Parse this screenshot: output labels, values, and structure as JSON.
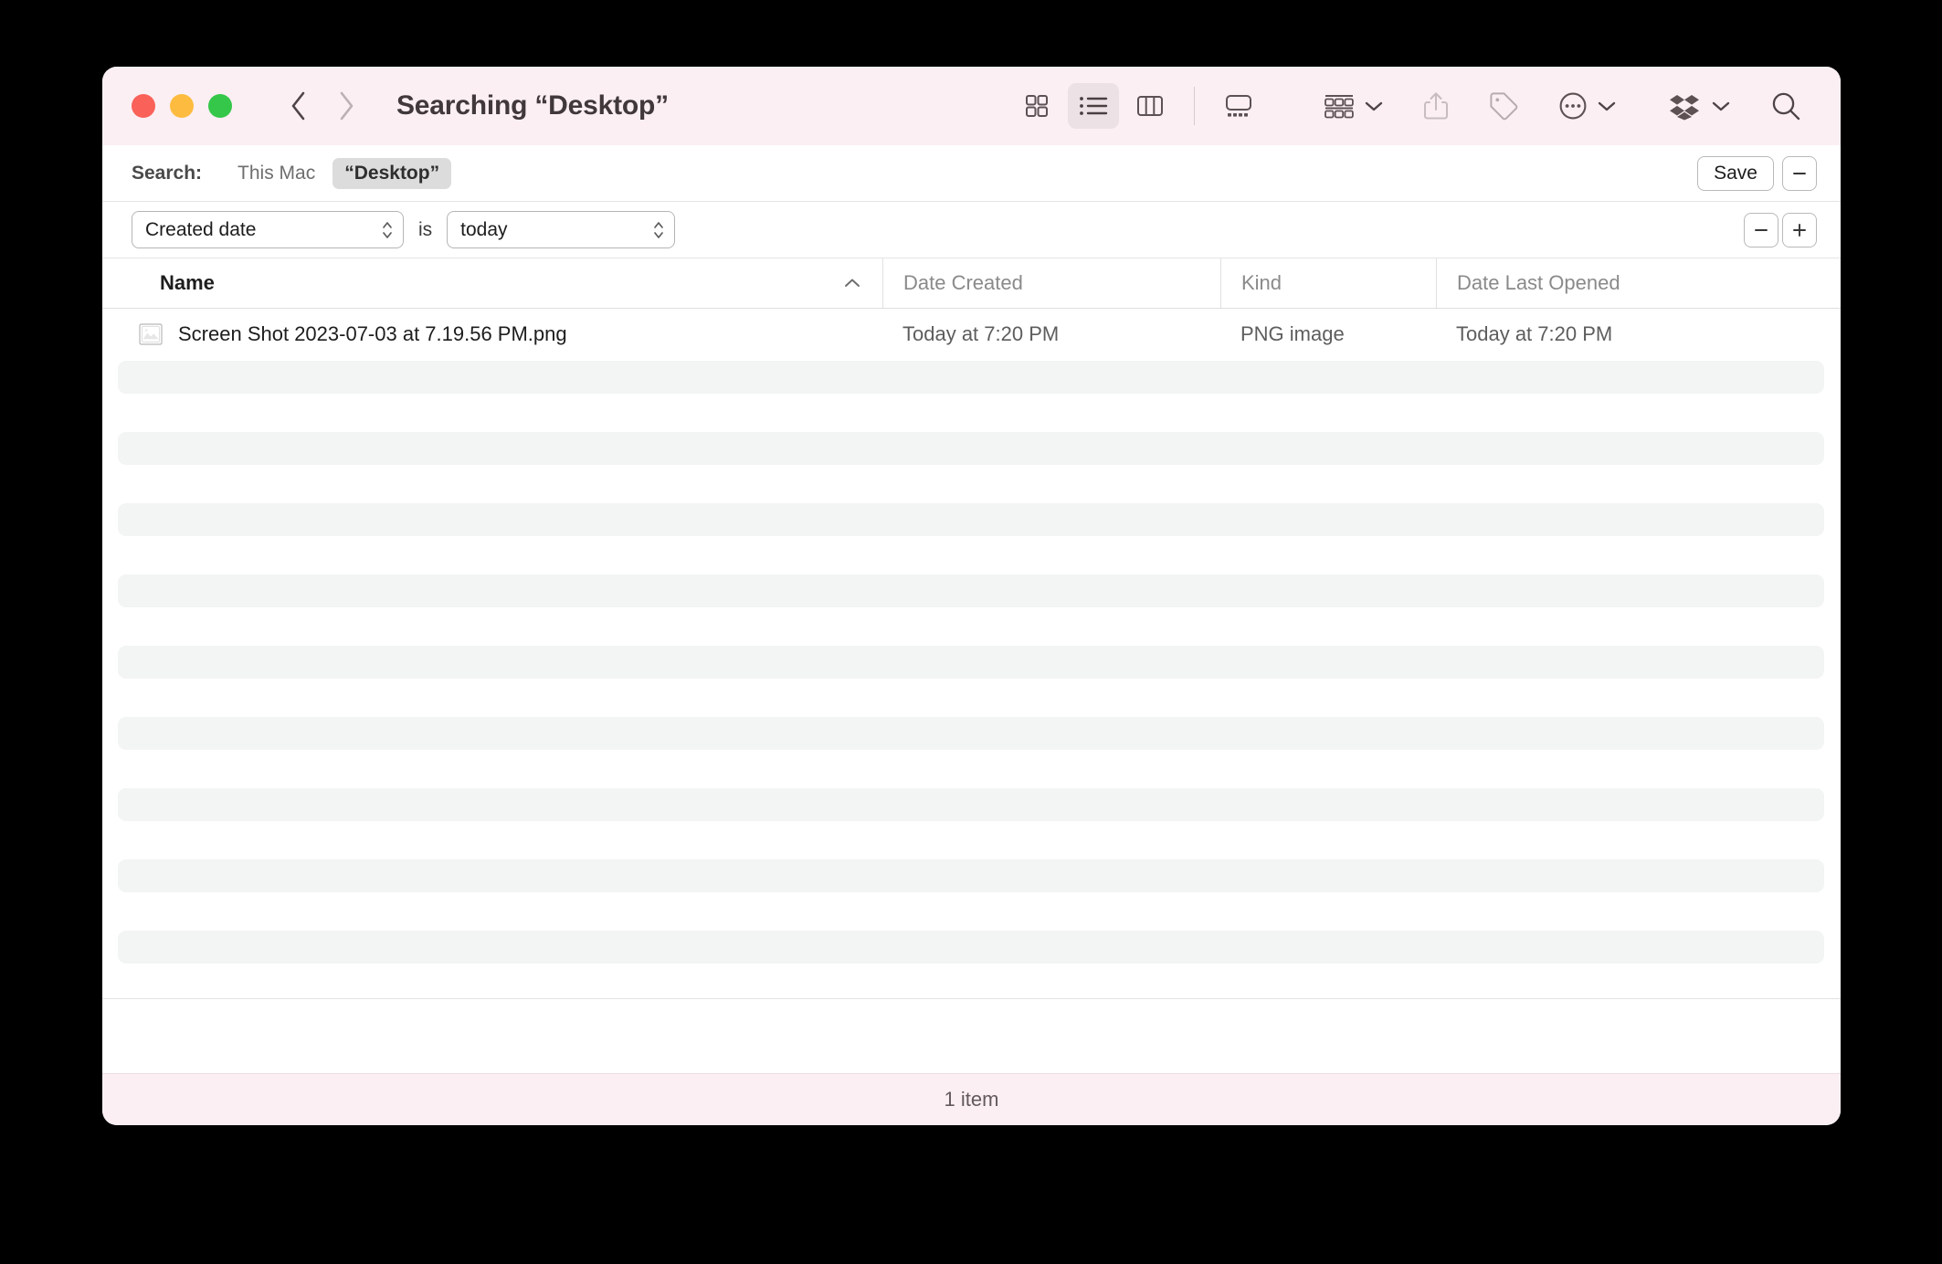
{
  "window": {
    "title": "Searching “Desktop”",
    "accent_titlebar": "#fbeff3",
    "accent_selected_chip": "#dcdcdc"
  },
  "titlebar": {
    "traffic": {
      "close_name": "close",
      "minimize_name": "minimize",
      "maximize_name": "maximize",
      "close_color": "#fa6159",
      "minimize_color": "#fdbc40",
      "maximize_color": "#34c749"
    },
    "nav": {
      "back": "back-icon",
      "forward": "forward-icon"
    },
    "views": [
      {
        "name": "icon-view",
        "icon": "grid-icon",
        "active": false
      },
      {
        "name": "list-view",
        "icon": "list-icon",
        "active": true
      },
      {
        "name": "column-view",
        "icon": "columns-icon",
        "active": false
      },
      {
        "name": "gallery-view",
        "icon": "gallery-icon",
        "active": false
      }
    ],
    "actions": [
      {
        "name": "group-by-button",
        "icon": "group-icon",
        "caret": true
      },
      {
        "name": "share-button",
        "icon": "share-icon",
        "caret": false
      },
      {
        "name": "tags-button",
        "icon": "tag-icon",
        "caret": false
      },
      {
        "name": "more-actions-button",
        "icon": "ellipsis-circle-icon",
        "caret": true
      },
      {
        "name": "dropbox-button",
        "icon": "dropbox-icon",
        "caret": true
      },
      {
        "name": "search-button",
        "icon": "search-icon",
        "caret": false
      }
    ]
  },
  "search_scope": {
    "label": "Search:",
    "options": [
      {
        "text": "This Mac",
        "selected": false
      },
      {
        "text": "“Desktop”",
        "selected": true
      }
    ],
    "save_label": "Save",
    "remove_label": "−"
  },
  "filter": {
    "attribute": "Created date",
    "operator": "is",
    "value": "today",
    "remove_label": "−",
    "add_label": "+"
  },
  "columns": [
    {
      "label": "Name",
      "sorted": true,
      "sort_direction": "ascending"
    },
    {
      "label": "Date Created",
      "sorted": false
    },
    {
      "label": "Kind",
      "sorted": false
    },
    {
      "label": "Date Last Opened",
      "sorted": false
    }
  ],
  "rows": [
    {
      "icon": "png-image-thumbnail-icon",
      "name": "Screen Shot 2023-07-03 at 7.19.56 PM.png",
      "date_created": "Today at 7:20 PM",
      "kind": "PNG image",
      "date_last_opened": "Today at 7:20 PM"
    }
  ],
  "status": {
    "item_count_text": "1 item"
  }
}
